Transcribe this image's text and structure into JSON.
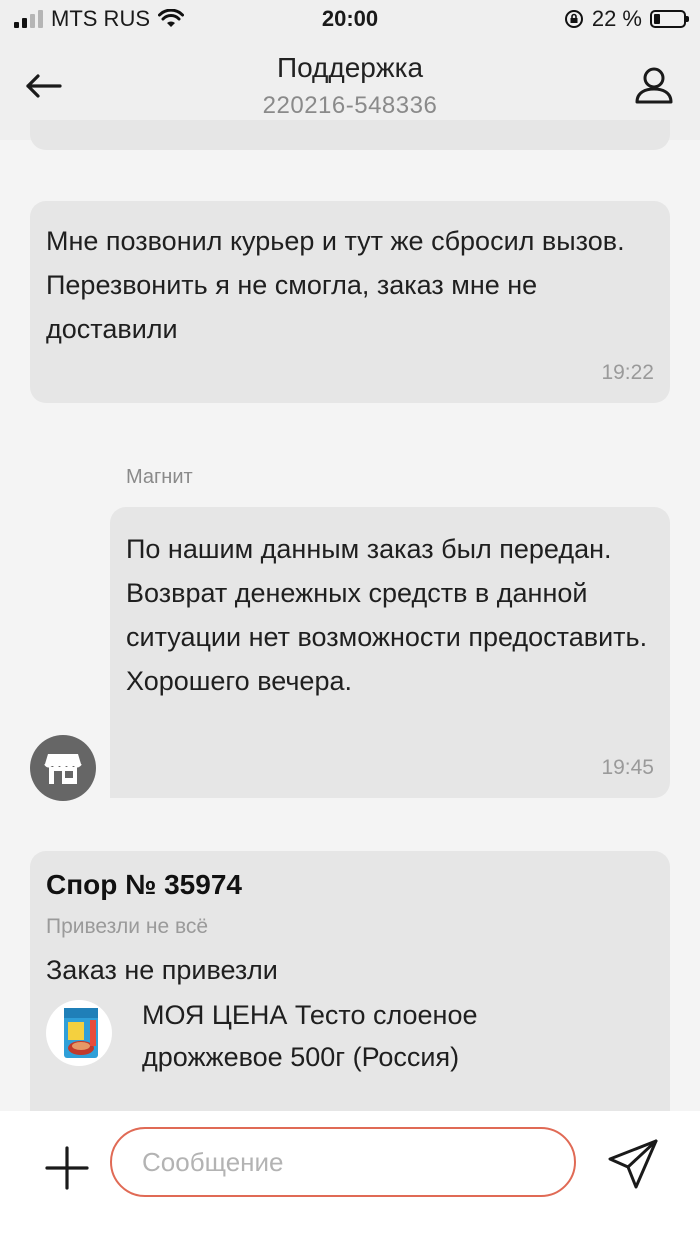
{
  "status_bar": {
    "carrier": "MTS RUS",
    "time": "20:00",
    "battery_percent": "22 %",
    "battery_level": 0.22
  },
  "header": {
    "title": "Поддержка",
    "subtitle": "220216-548336"
  },
  "messages": [
    {
      "text": "Мне позвонил курьер и тут же сбросил вызов. Перезвонить я не смогла, заказ мне не доставили",
      "time": "19:22"
    },
    {
      "sender": "Магнит",
      "text": "По нашим данным заказ был передан. Возврат денежных средств в данной ситуации нет возможности предоставить. Хорошего вечера.",
      "time": "19:45"
    }
  ],
  "dispute": {
    "title": "Спор № 35974",
    "subtitle": "Привезли не всё",
    "description": "Заказ не привезли",
    "product_name": "МОЯ ЦЕНА Тесто слоеное дрожжевое 500г (Россия)"
  },
  "composer": {
    "placeholder": "Сообщение"
  },
  "icons": {
    "back": "arrow-left-icon",
    "profile": "user-icon",
    "store": "store-icon",
    "add": "plus-icon",
    "send": "send-icon"
  },
  "colors": {
    "input_border": "#e06a55",
    "bubble": "#e6e6e6",
    "background": "#f4f4f4"
  }
}
